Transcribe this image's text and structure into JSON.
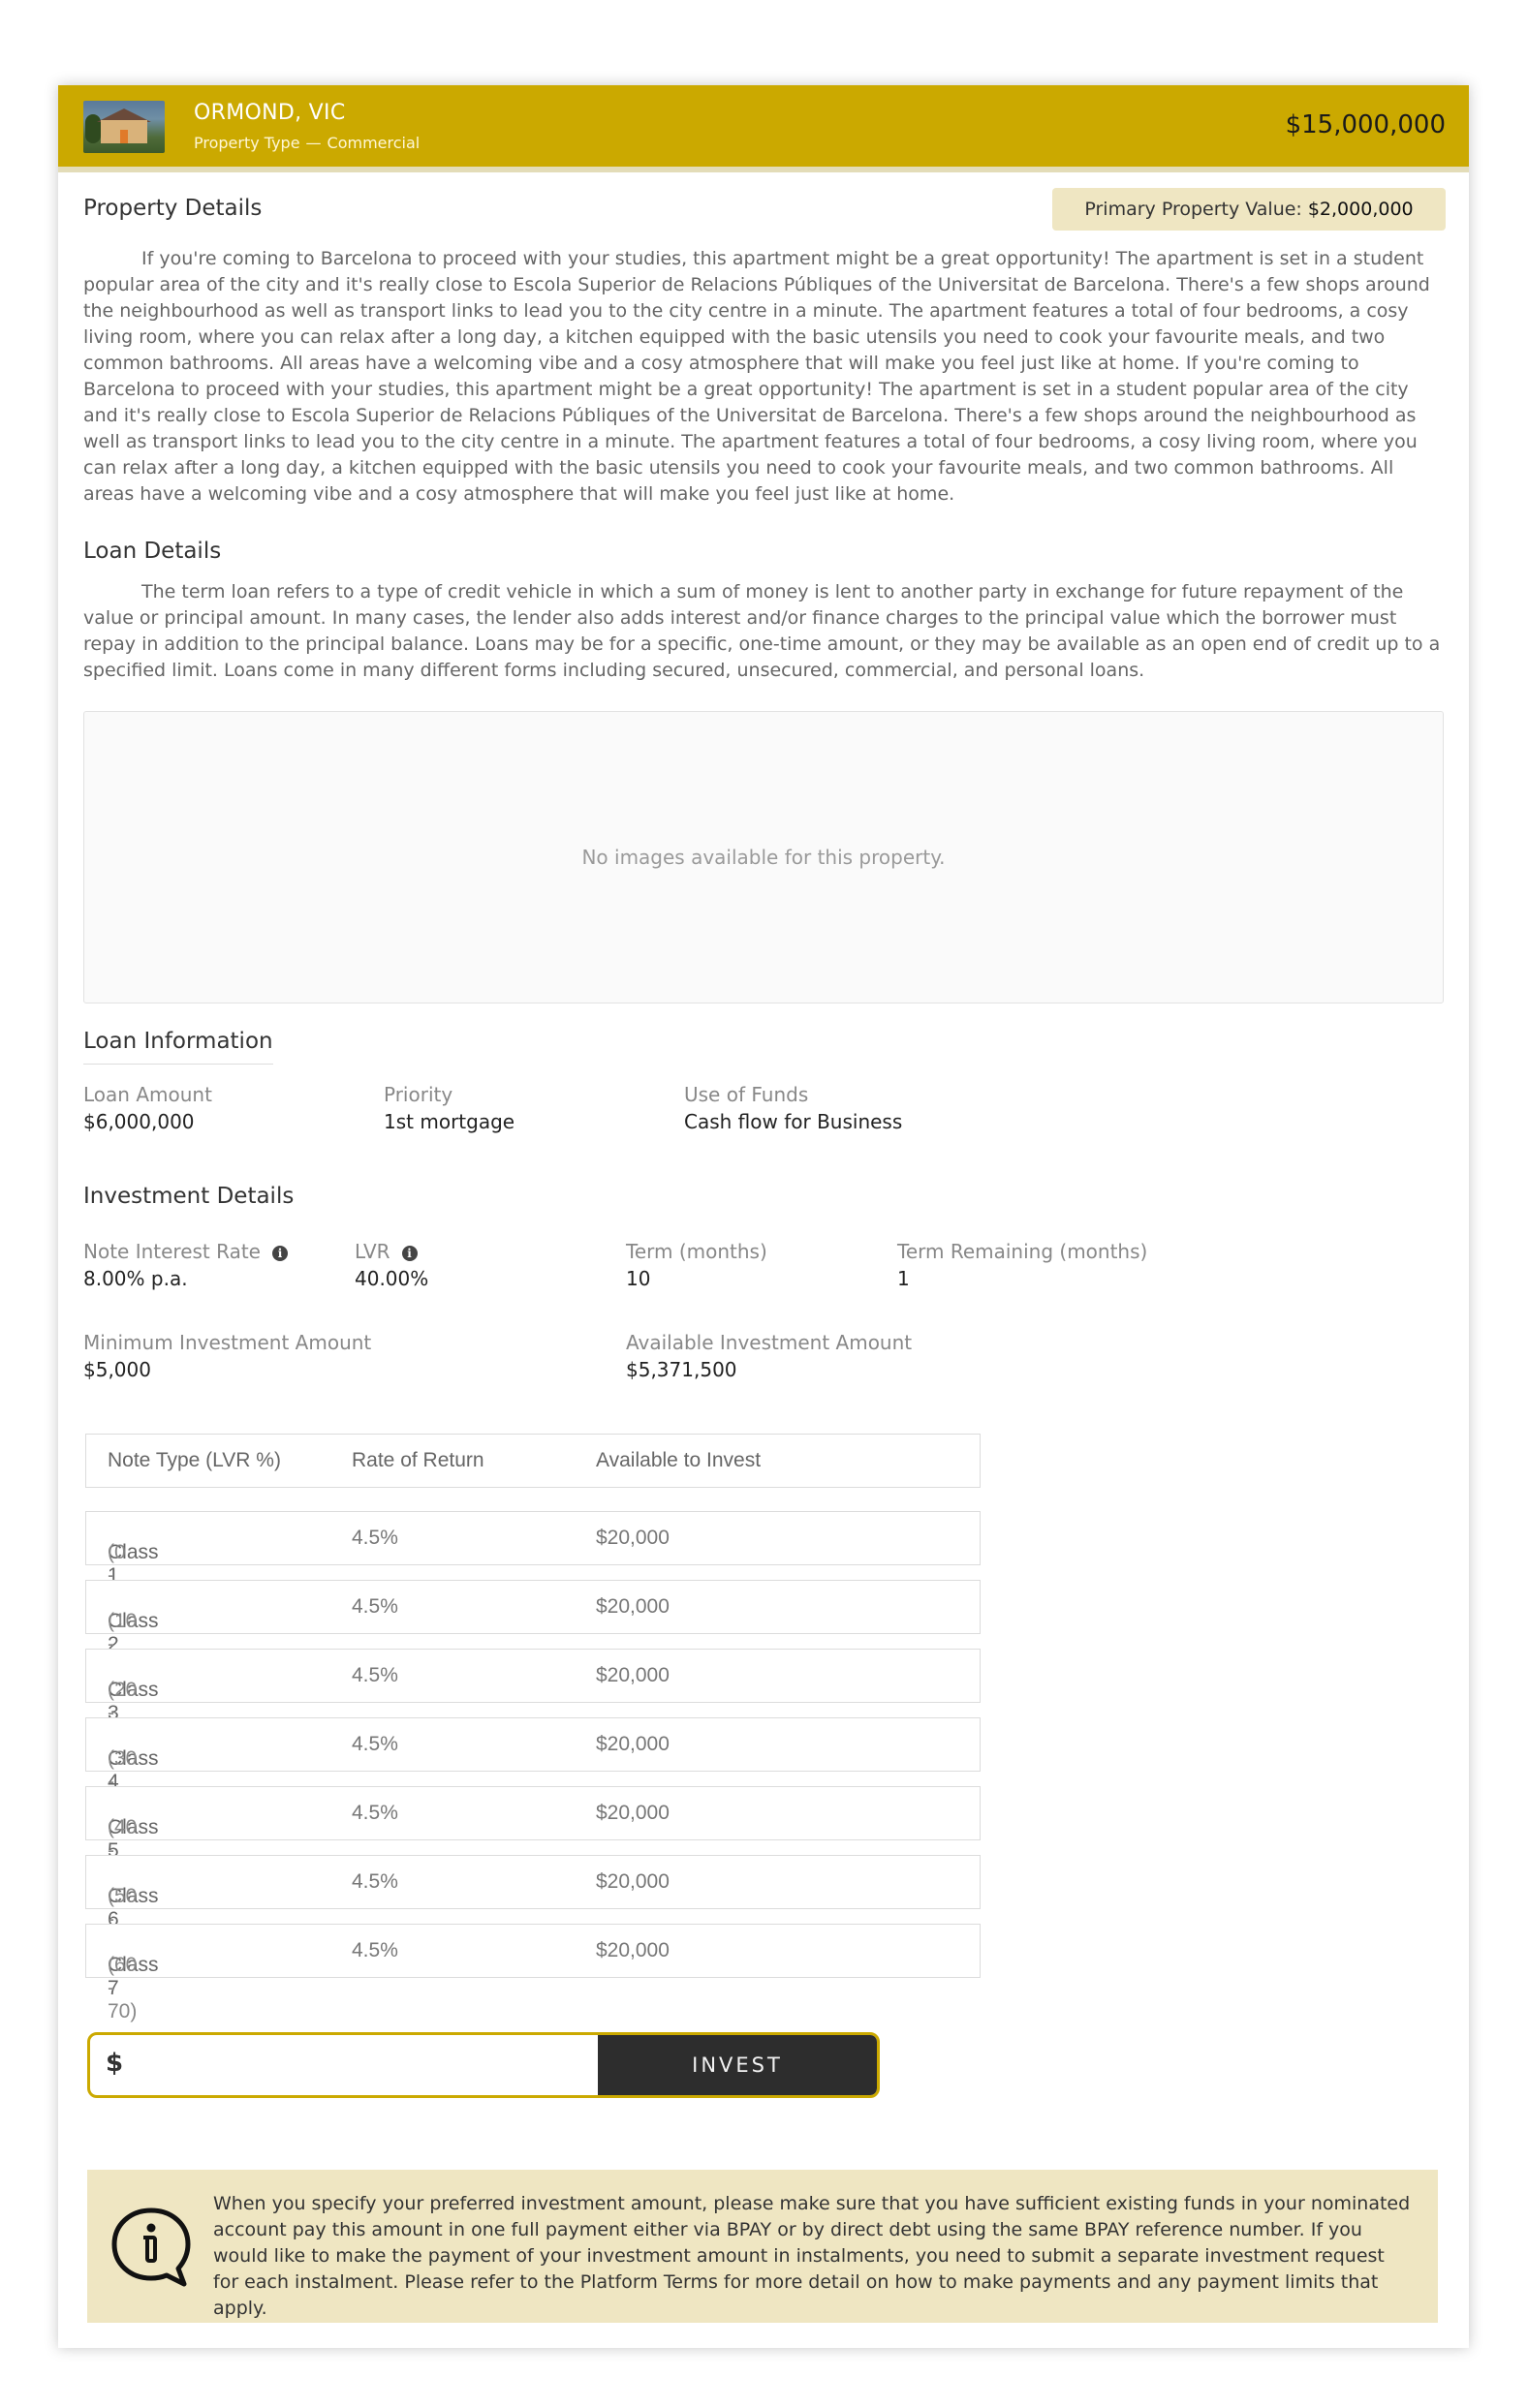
{
  "header": {
    "title": "ORMOND, VIC",
    "property_type_label": "Property Type",
    "property_type_dash": "—",
    "property_type_value": "Commercial",
    "price": "$15,000,000",
    "accent_color": "#cba900"
  },
  "property_details": {
    "title": "Property Details",
    "primary_value_label": "Primary Property Value:",
    "primary_value": "$2,000,000",
    "description": "If you're coming to Barcelona to proceed with your studies, this apartment might be a great opportunity! The apartment is set in a student popular area of the city and it's really close to Escola Superior de Relacions Públiques of the Universitat de Barcelona. There's a few shops around the neighbourhood as well as transport links to lead you to the city centre in a minute. The apartment features a total of four bedrooms, a cosy living room, where you can relax after a long day, a kitchen equipped with the basic utensils you need to cook your favourite meals, and two common bathrooms. All areas have a welcoming vibe and a cosy atmosphere that will make you feel just like at home. If you're coming to Barcelona to proceed with your studies, this apartment might be a great opportunity! The apartment is set in a student popular area of the city and it's really close to Escola Superior de Relacions Públiques of the Universitat de Barcelona. There's a few shops around the neighbourhood as well as transport links to lead you to the city centre in a minute. The apartment features a total of four bedrooms, a cosy living room, where you can relax after a long day, a kitchen equipped with the basic utensils you need to cook your favourite meals, and two common bathrooms. All areas have a welcoming vibe and a cosy atmosphere that will make you feel just like at home."
  },
  "loan_details": {
    "title": "Loan Details",
    "description": "The term loan refers to a type of credit vehicle in which a sum of money is lent to another party in exchange for future repayment of the value or principal amount. In many cases, the lender also adds interest and/or finance charges to the principal value which the borrower must repay in addition to the principal balance. Loans may be for a specific, one-time amount, or they may be available as an  open end of credit up to a specified limit. Loans come in many different forms including secured, unsecured, commercial, and personal loans."
  },
  "images": {
    "empty_text": "No images available for this property."
  },
  "loan_information": {
    "title": "Loan Information",
    "loan_amount_label": "Loan Amount",
    "loan_amount": "$6,000,000",
    "priority_label": "Priority",
    "priority": "1st mortgage",
    "use_of_funds_label": "Use of Funds",
    "use_of_funds": "Cash flow for Business"
  },
  "investment_details": {
    "title": "Investment Details",
    "interest_rate_label": "Note Interest Rate",
    "interest_rate": "8.00% p.a.",
    "lvr_label": "LVR",
    "lvr": "40.00%",
    "term_label": "Term (months)",
    "term": "10",
    "term_remaining_label": "Term Remaining (months)",
    "term_remaining": "1",
    "min_investment_label": "Minimum Investment Amount",
    "min_investment": "$5,000",
    "available_investment_label": "Available Investment Amount",
    "available_investment": "$5,371,500"
  },
  "notes_table": {
    "headers": [
      "Note Type (LVR %)",
      "Rate of Return",
      "Available to Invest"
    ],
    "rows": [
      {
        "class": "Class 1",
        "range": "(0 - 10)",
        "rate": "4.5%",
        "available": "$20,000"
      },
      {
        "class": "Class 2",
        "range": "(10 - 20)",
        "rate": "4.5%",
        "available": "$20,000"
      },
      {
        "class": "Class 3",
        "range": "(20 - 30)",
        "rate": "4.5%",
        "available": "$20,000"
      },
      {
        "class": "Class 4",
        "range": "(30 - 40)",
        "rate": "4.5%",
        "available": "$20,000"
      },
      {
        "class": "Class 5",
        "range": "(40 - 50)",
        "rate": "4.5%",
        "available": "$20,000"
      },
      {
        "class": "Class 6",
        "range": "(50 - 60)",
        "rate": "4.5%",
        "available": "$20,000"
      },
      {
        "class": "Class 7",
        "range": "(60 - 70)",
        "rate": "4.5%",
        "available": "$20,000"
      }
    ]
  },
  "invest_form": {
    "currency_symbol": "$",
    "amount_value": "",
    "button_label": "INVEST"
  },
  "notice": {
    "icon": "info-speech-bubble-icon",
    "text": "When you specify your preferred investment amount, please make sure that you have sufficient existing funds in your nominated account pay this amount in one full payment either via BPAY or by direct debt using the same BPAY reference number. If you would like to make the payment of your investment amount in instalments, you need to submit a separate investment request for each instalment. Please refer to the Platform Terms for more detail on how to make payments and any payment limits that apply."
  }
}
